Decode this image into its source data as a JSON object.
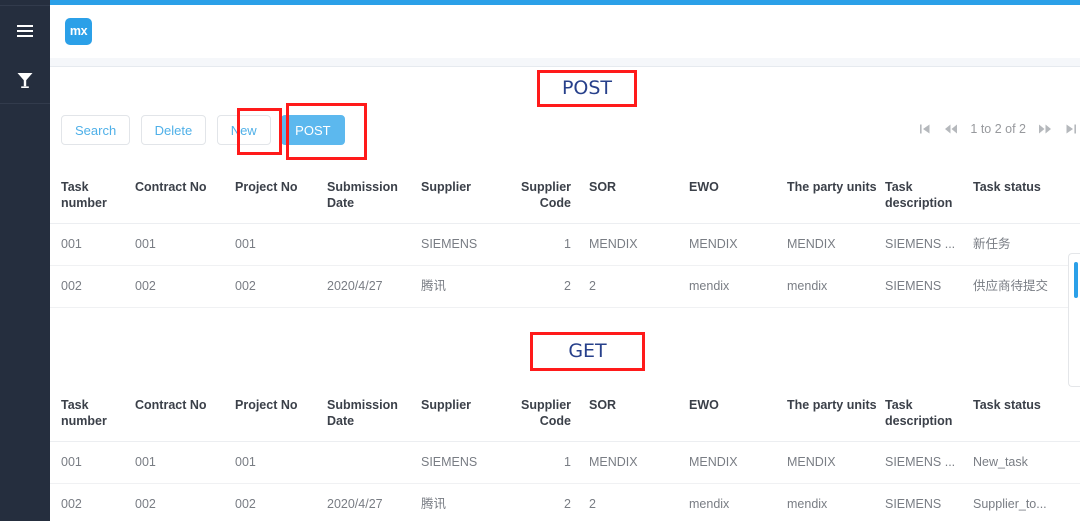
{
  "app": {
    "logo_text": "mx",
    "accent_color": "#2ba0e8",
    "annotation_color": "#ff1a1a",
    "section_label_color": "#27408b"
  },
  "sidebar": {
    "items": [
      {
        "icon": "hamburger-menu-icon",
        "label": ""
      },
      {
        "icon": "funnel-filter-icon",
        "label": ""
      }
    ]
  },
  "toolbar": {
    "search_label": "Search",
    "delete_label": "Delete",
    "new_label": "New",
    "post_label": "POST"
  },
  "pagination": {
    "first_icon": "first-page-icon",
    "prev_icon": "previous-page-icon",
    "status": "1 to 2 of 2",
    "next_icon": "next-page-icon",
    "last_icon": "last-page-icon"
  },
  "sections": [
    {
      "id": "post",
      "label": "POST",
      "columns": [
        "Task number",
        "Contract No",
        "Project No",
        "Submission Date",
        "Supplier",
        "Supplier Code",
        "SOR",
        "EWO",
        "The party units",
        "Task description",
        "Task status"
      ],
      "rows": [
        {
          "task_number": "001",
          "contract_no": "001",
          "project_no": "001",
          "submission_date": "",
          "supplier": "SIEMENS",
          "supplier_code": "1",
          "sor": "MENDIX",
          "ewo": "MENDIX",
          "party_units": "MENDIX",
          "task_description": "SIEMENS ...",
          "task_status": "新任务"
        },
        {
          "task_number": "002",
          "contract_no": "002",
          "project_no": "002",
          "submission_date": "2020/4/27",
          "supplier": "腾讯",
          "supplier_code": "2",
          "sor": "2",
          "ewo": "mendix",
          "party_units": "mendix",
          "task_description": "SIEMENS",
          "task_status": "供应商待提交"
        }
      ]
    },
    {
      "id": "get",
      "label": "GET",
      "columns": [
        "Task number",
        "Contract No",
        "Project No",
        "Submission Date",
        "Supplier",
        "Supplier Code",
        "SOR",
        "EWO",
        "The party units",
        "Task description",
        "Task status"
      ],
      "rows": [
        {
          "task_number": "001",
          "contract_no": "001",
          "project_no": "001",
          "submission_date": "",
          "supplier": "SIEMENS",
          "supplier_code": "1",
          "sor": "MENDIX",
          "ewo": "MENDIX",
          "party_units": "MENDIX",
          "task_description": "SIEMENS ...",
          "task_status": "New_task"
        },
        {
          "task_number": "002",
          "contract_no": "002",
          "project_no": "002",
          "submission_date": "2020/4/27",
          "supplier": "腾讯",
          "supplier_code": "2",
          "sor": "2",
          "ewo": "mendix",
          "party_units": "mendix",
          "task_description": "SIEMENS",
          "task_status": "Supplier_to..."
        }
      ]
    }
  ]
}
